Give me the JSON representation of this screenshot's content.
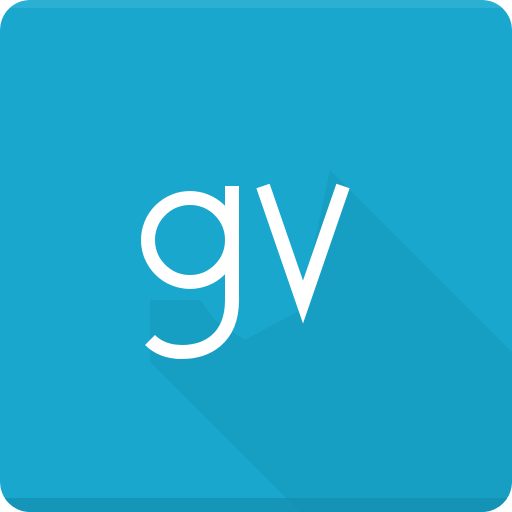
{
  "icon": {
    "name": "gv-app-icon",
    "logo_text": "gv",
    "colors": {
      "background": "#1AA7CD",
      "background_top_highlight": "#3AB8DA",
      "bottom_edge": "#1595B8",
      "long_shadow": "#158FB3",
      "glyph": "#FFFFFF"
    }
  }
}
